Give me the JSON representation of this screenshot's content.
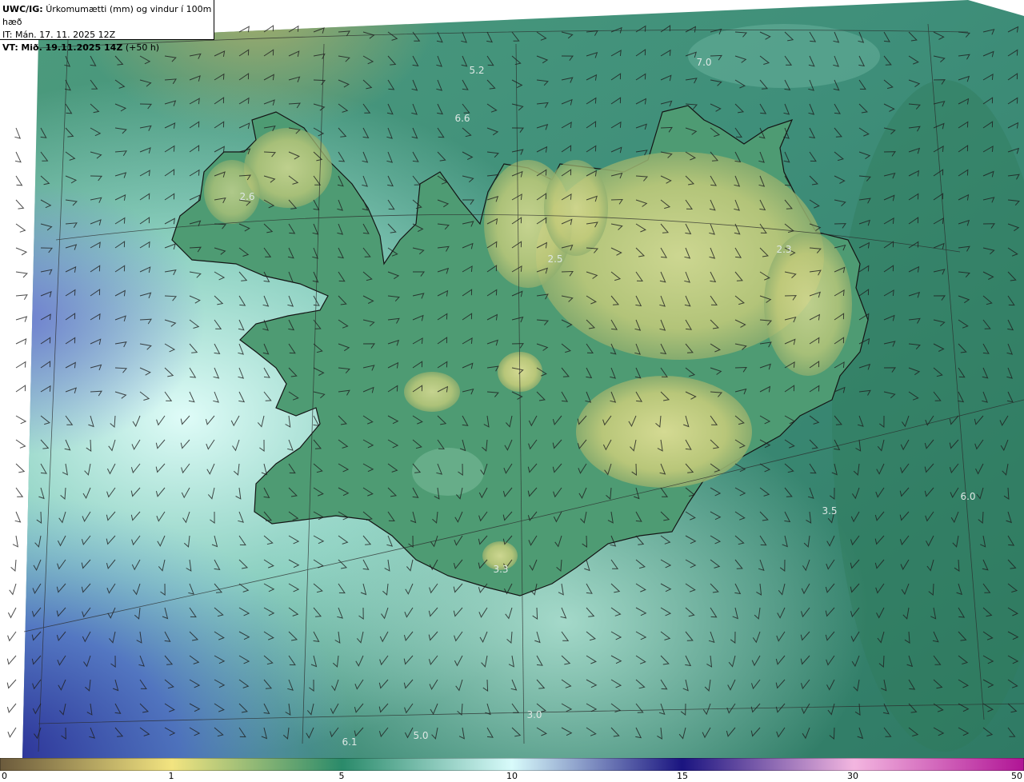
{
  "header": {
    "model": "UWC/IG:",
    "title": "Úrkomumætti (mm) og vindur í 100m hæð",
    "issue": "IT: Mán. 17. 11. 2025 12Z",
    "valid_prefix": "VT:",
    "valid": "Mið. 19.11.2025 14Z",
    "lead": "(+50 h)"
  },
  "map_labels": [
    {
      "text": "5.2"
    },
    {
      "text": "7.0"
    },
    {
      "text": "6.6"
    },
    {
      "text": "2.6"
    },
    {
      "text": "2.5"
    },
    {
      "text": "2.3"
    },
    {
      "text": "6.0"
    },
    {
      "text": "3.5"
    },
    {
      "text": "3.3"
    },
    {
      "text": "3.0"
    },
    {
      "text": "5.0"
    },
    {
      "text": "6.1"
    }
  ],
  "colorbar": {
    "ticks": [
      "0",
      "1",
      "5",
      "10",
      "15",
      "30",
      "50"
    ],
    "colors": [
      "#6b5a3c",
      "#f2e480",
      "#2a8a6a",
      "#d8fbfb",
      "#1a1480",
      "#f3b6e0",
      "#b01495"
    ]
  },
  "colors": {
    "ocean_base": "#3f8f7a",
    "land_low": "#c9cf7c",
    "coastline": "#141414",
    "gridline": "#2a2a2a"
  }
}
